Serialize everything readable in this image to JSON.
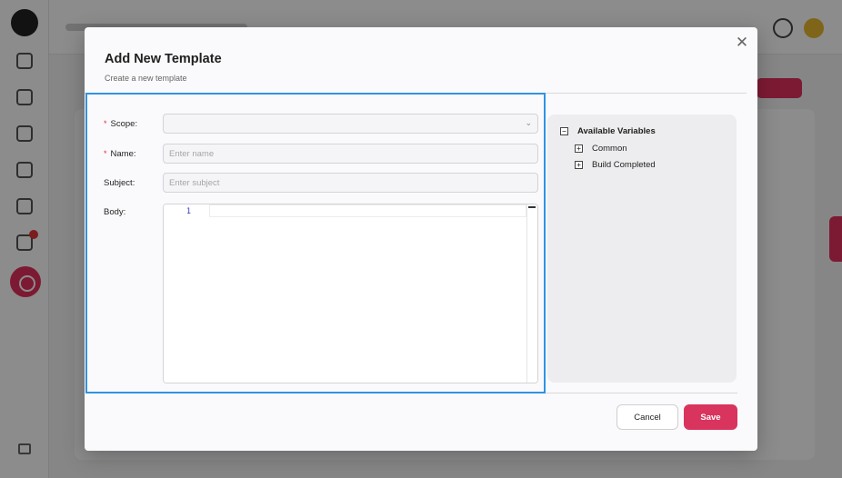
{
  "colors": {
    "accent": "#d9345e",
    "focus_outline": "#2f93e4",
    "required_marker": "#e0333a",
    "line_number": "#3b3bbf"
  },
  "modal": {
    "title": "Add New Template",
    "subtitle": "Create a new template",
    "close_icon": "close-icon"
  },
  "form": {
    "scope": {
      "label": "Scope",
      "required_marker": "*",
      "value": "",
      "chevron": "⌄"
    },
    "name": {
      "label": "Name",
      "required_marker": "*",
      "placeholder": "Enter name"
    },
    "subject": {
      "label": "Subject",
      "placeholder": "Enter subject"
    },
    "body": {
      "label": "Body",
      "line_numbers": [
        "1"
      ]
    },
    "label_suffix": " :"
  },
  "variables": {
    "title": "Available Variables",
    "root_toggle": "−",
    "items": [
      {
        "label": "Common",
        "toggle": "+"
      },
      {
        "label": "Build Completed",
        "toggle": "+"
      }
    ]
  },
  "footer": {
    "cancel_label": "Cancel",
    "save_label": "Save"
  }
}
